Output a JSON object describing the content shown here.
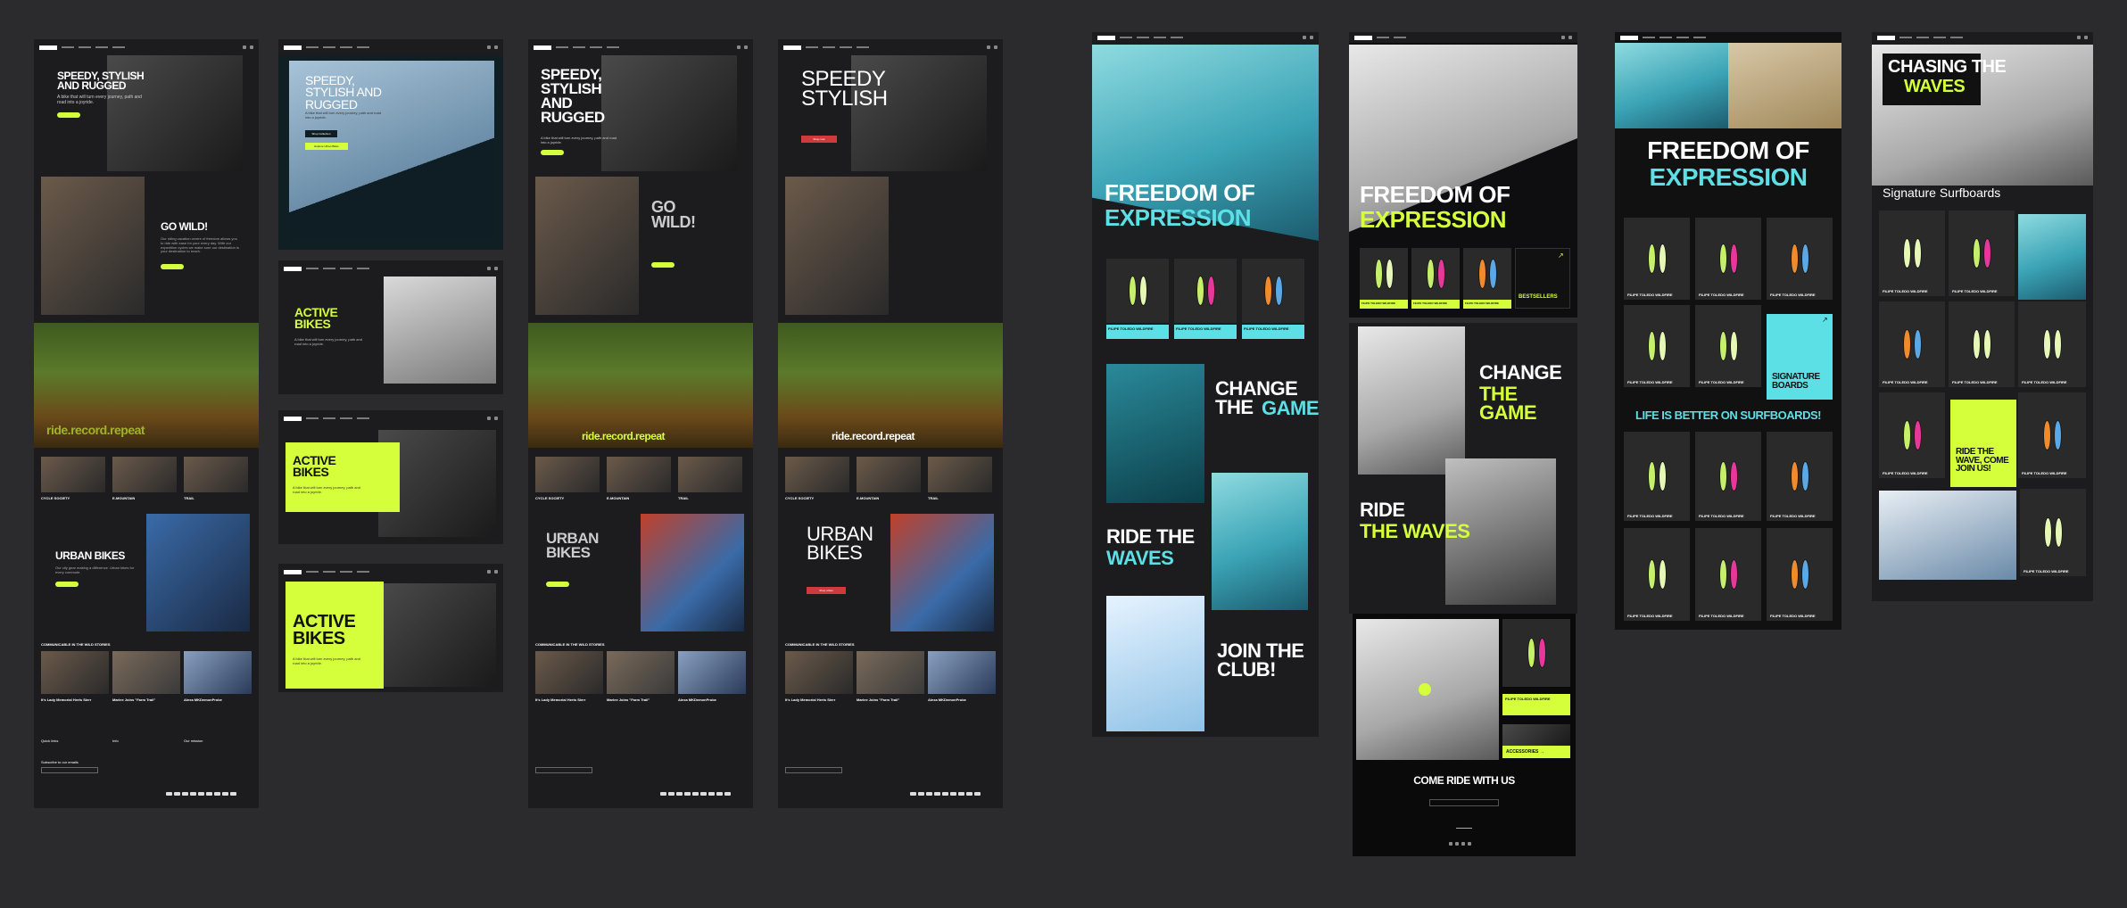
{
  "boards": {
    "bike1": {
      "hero_title": "SPEEDY, STYLISH AND RUGGED",
      "hero_sub": "A bike that will turn every journey, path and road into a joyride.",
      "hero_btn": "Shop now",
      "go_wild_title": "GO WILD!",
      "go_wild_body": "Our riding vacation centre of freedom allows you to ride with ease for your every day. With our expedition cycles we make sure our destination is your destination to reach.",
      "go_wild_btn": "Shop mountain",
      "tagline": "ride.record.repeat",
      "thumbs": [
        "CYCLE SOCIETY",
        "E-MOUNTAIN",
        "TRAIL"
      ],
      "urban_title": "URBAN BIKES",
      "urban_body": "Our city gear making a difference. Urban bikes for every commute.",
      "urban_btn": "Shop urban",
      "stories_heading": "COMMUNICABLE IN THE WILD STORIES",
      "stories": [
        "It's Lady Memorial Herts Sierr",
        "Marlee Joins \"Farm Trail\"",
        "Alexa MKDemonProbe"
      ],
      "footer_cols": [
        "Quick links",
        "Info",
        "Our mission"
      ],
      "subscribe": "Subscribe to our emails"
    },
    "bike2": {
      "hero_title": "SPEEDY, STYLISH AND RUGGED",
      "hero_sub": "A bike that will turn every journey, path and road into a joyride.",
      "hero_btn1": "Shop Collection",
      "hero_btn2": "Explore Urban Bikes"
    },
    "bike3": {
      "title": "ACTIVE BIKES",
      "body": "A bike that will turn every journey, path and road into a joyride."
    },
    "bike4": {
      "title": "ACTIVE BIKES",
      "body": "A bike that will turn every journey, path and road into a joyride."
    },
    "bike5": {
      "title": "ACTIVE BIKES",
      "body": "A bike that will turn every journey, path and road into a joyride."
    },
    "bike6": {
      "hero_title": "SPEEDY, STYLISH AND RUGGED",
      "hero_sub": "A bike that will turn every journey, path and road into a joyride.",
      "hero_btn": "Shop now",
      "go_wild_title": "GO WILD!",
      "go_wild_btn": "Shop mountain",
      "tagline": "ride.record.repeat",
      "thumbs": [
        "CYCLE SOCIETY",
        "E-MOUNTAIN",
        "TRAIL"
      ],
      "urban_title": "URBAN BIKES",
      "urban_btn": "Shop urban",
      "stories_heading": "COMMUNICABLE IN THE WILD STORIES",
      "stories": [
        "It's Lady Memorial Herts Sierr",
        "Marlee Joins \"Farm Trail\"",
        "Alexa MKDemonProbe"
      ]
    },
    "bike7": {
      "hero_title": "SPEEDY STYLISH",
      "hero_btn": "Shop now",
      "tagline": "ride.record.repeat",
      "thumbs": [
        "CYCLE SOCIETY",
        "E-MOUNTAIN",
        "TRAIL"
      ],
      "urban_title": "URBAN BIKES",
      "urban_btn": "Shop urban",
      "stories_heading": "COMMUNICABLE IN THE WILD STORIES",
      "stories": [
        "It's Lady Memorial Herts Sierr",
        "Marlee Joins \"Farm Trail\"",
        "Alexa MKDemonProbe"
      ]
    },
    "surf1": {
      "hero_title_1": "FREEDOM OF",
      "hero_title_2": "EXPRESSION",
      "product_name": "FILIPE TOLEDO WILDFIRE",
      "change_title_1": "CHANGE THE",
      "change_title_2": "GAME",
      "ride_title_1": "RIDE THE",
      "ride_title_2": "WAVES",
      "join_title": "JOIN THE CLUB!"
    },
    "surf2": {
      "hero_title_1": "FREEDOM OF",
      "hero_title_2": "EXPRESSION",
      "bestsellers": "BESTSELLERS",
      "product_name": "FILIPE TOLEDO WILDFIRE",
      "change_title_1": "CHANGE",
      "change_title_2": "THE GAME",
      "ride_title_1": "RIDE",
      "ride_title_2": "THE WAVES",
      "accessories": "ACCESSORIES →",
      "come_ride": "COME RIDE WITH US"
    },
    "surf3": {
      "hero_title_1": "FREEDOM OF",
      "hero_title_2": "EXPRESSION",
      "product_name": "FILIPE TOLEDO WILDFIRE",
      "signature": "SIGNATURE BOARDS",
      "life": "LIFE IS BETTER ON SURFBOARDS!"
    },
    "surf4": {
      "hero_title_1": "CHASING THE",
      "hero_title_2": "WAVES",
      "section": "Signature Surfboards",
      "product_name": "FILIPE TOLEDO WILDFIRE",
      "promo": "RIDE THE WAVE, COME JOIN US!"
    }
  },
  "colors": {
    "lime": "#d4ff3a",
    "cyan": "#5ce0e6",
    "bg": "#2b2b2d",
    "panel": "#1c1c1e"
  }
}
